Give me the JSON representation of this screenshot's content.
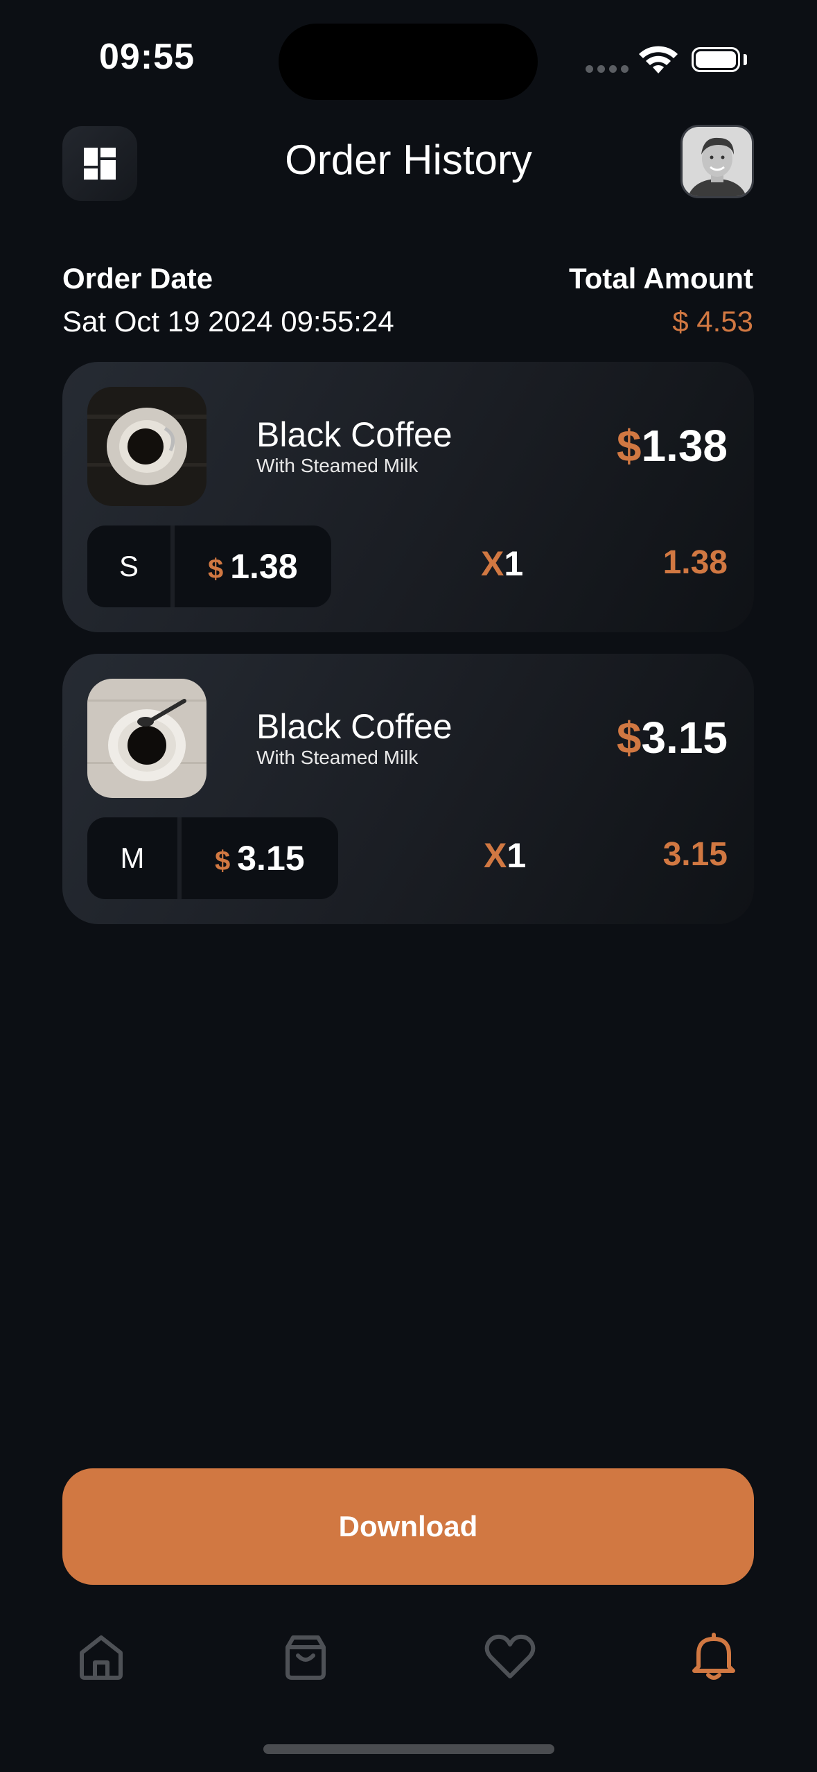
{
  "status_bar": {
    "time": "09:55"
  },
  "header": {
    "title": "Order History"
  },
  "order": {
    "date_label": "Order Date",
    "date_value": "Sat Oct 19 2024 09:55:24",
    "total_label": "Total Amount",
    "total_value": "$ 4.53"
  },
  "items": [
    {
      "name": "Black Coffee",
      "subtitle": "With Steamed Milk",
      "price_symbol": "$",
      "price": "1.38",
      "size": "S",
      "unit_symbol": "$",
      "unit_price": "1.38",
      "qty_prefix": "X",
      "qty": "1",
      "line_total": "1.38"
    },
    {
      "name": "Black Coffee",
      "subtitle": "With Steamed Milk",
      "price_symbol": "$",
      "price": "3.15",
      "size": "M",
      "unit_symbol": "$",
      "unit_price": "3.15",
      "qty_prefix": "X",
      "qty": "1",
      "line_total": "3.15"
    }
  ],
  "actions": {
    "download_label": "Download"
  },
  "tab_bar": {
    "items": [
      {
        "icon": "home-icon",
        "active": false
      },
      {
        "icon": "bag-icon",
        "active": false
      },
      {
        "icon": "heart-icon",
        "active": false
      },
      {
        "icon": "bell-icon",
        "active": true
      }
    ]
  },
  "colors": {
    "accent": "#d17842",
    "background": "#0c0f14",
    "card": "#1f2329",
    "inactive_icon": "#4e5156"
  }
}
